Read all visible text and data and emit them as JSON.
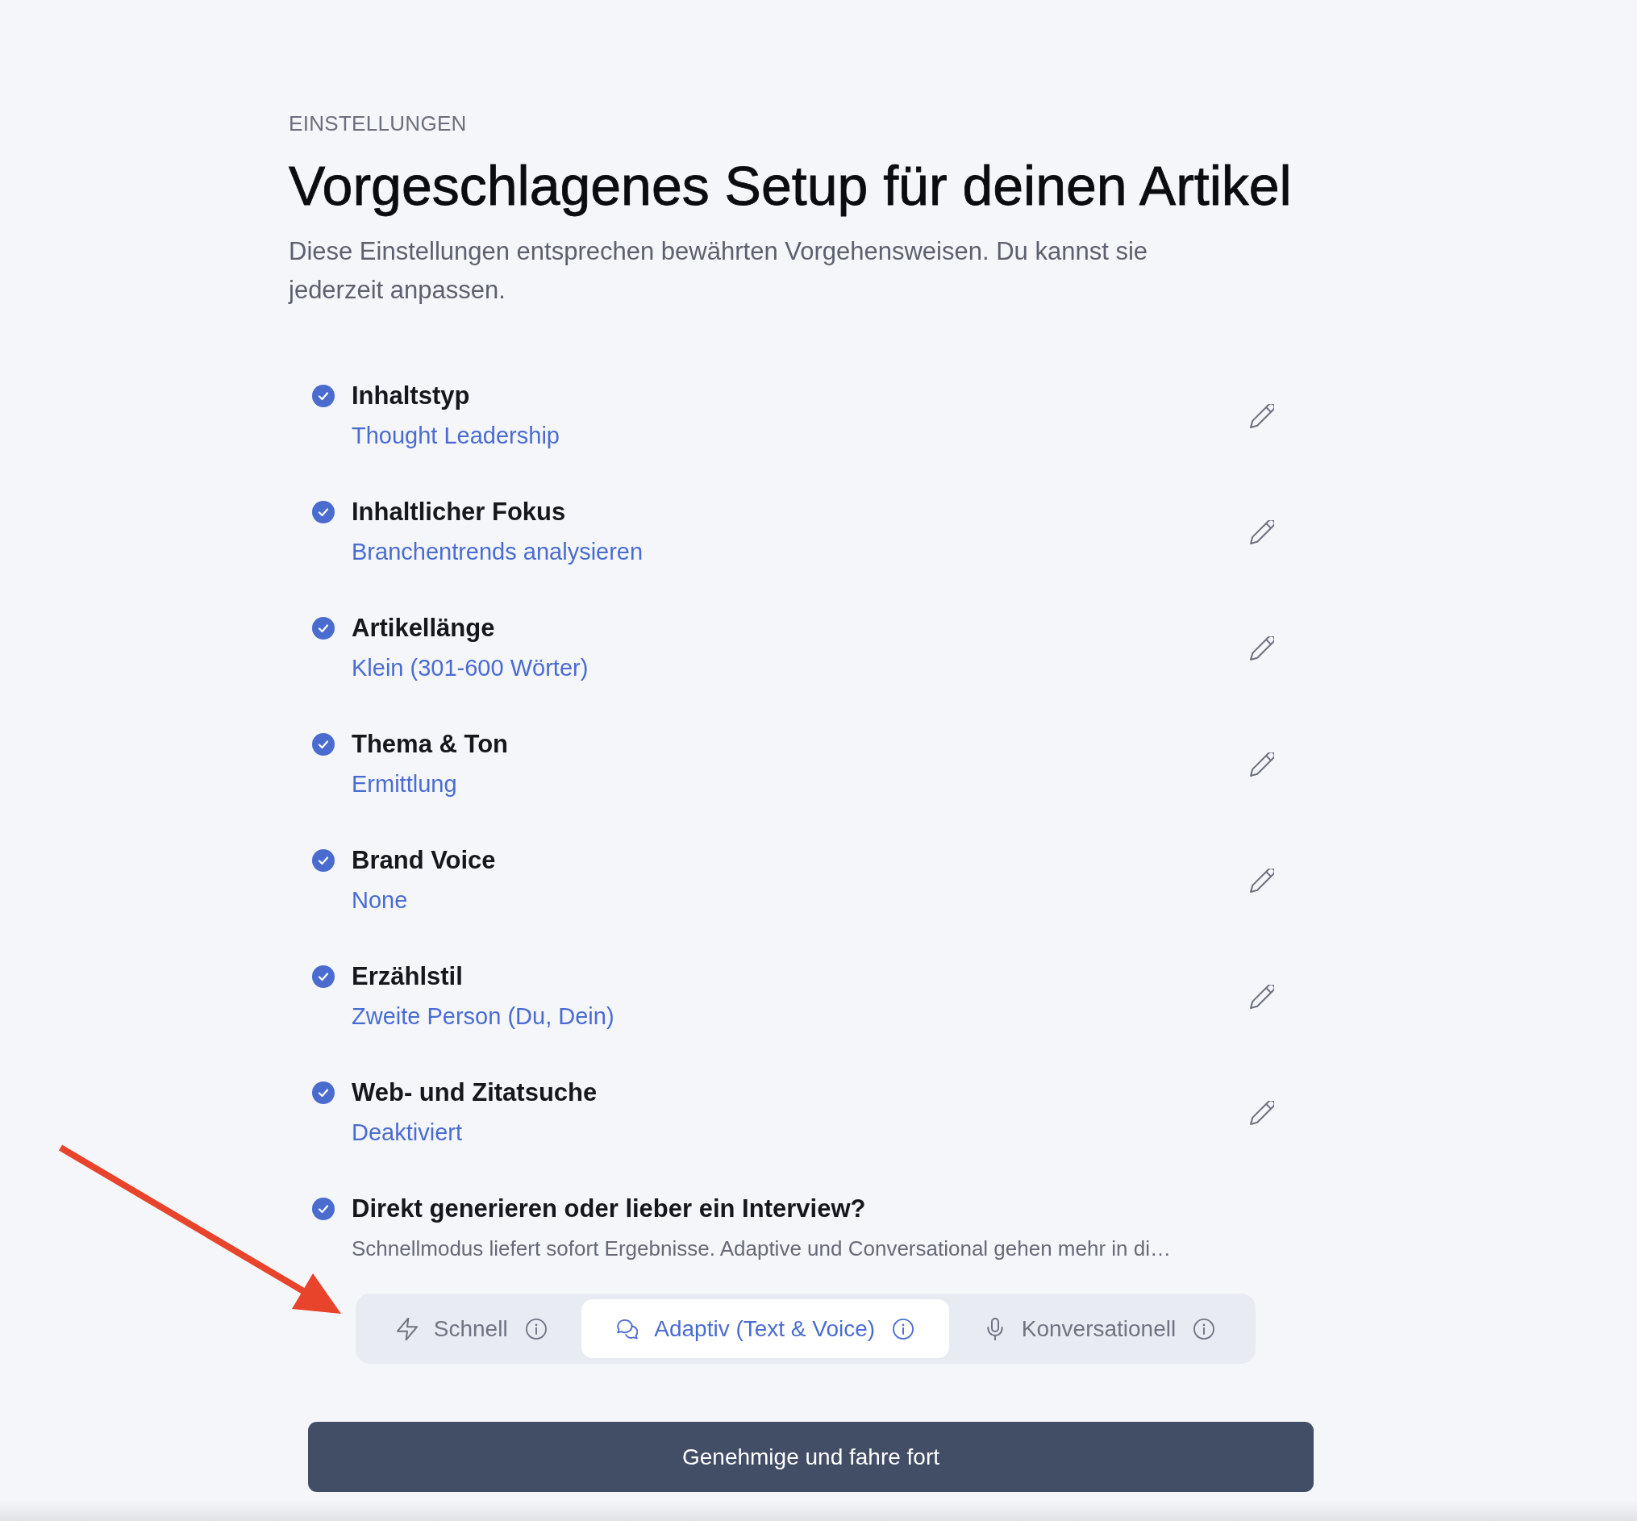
{
  "header": {
    "eyebrow": "EINSTELLUNGEN",
    "title": "Vorgeschlagenes Setup für deinen Artikel",
    "description": "Diese Einstellungen entsprechen bewährten Vorgehensweisen. Du kannst sie jederzeit anpassen."
  },
  "settings": [
    {
      "kind": "value",
      "checked": true,
      "label": "Inhaltstyp",
      "value": "Thought Leadership"
    },
    {
      "kind": "value",
      "checked": true,
      "label": "Inhaltlicher Fokus",
      "value": "Branchentrends analysieren"
    },
    {
      "kind": "value",
      "checked": true,
      "label": "Artikellänge",
      "value": "Klein (301-600 Wörter)"
    },
    {
      "kind": "value",
      "checked": true,
      "label": "Thema & Ton",
      "value": "Ermittlung"
    },
    {
      "kind": "value",
      "checked": true,
      "label": "Brand Voice",
      "value": "None"
    },
    {
      "kind": "value",
      "checked": true,
      "label": "Erzählstil",
      "value": "Zweite Person (Du, Dein)"
    },
    {
      "kind": "value",
      "checked": true,
      "label": "Web- und Zitatsuche",
      "value": "Deaktiviert"
    },
    {
      "kind": "choice",
      "checked": true,
      "label": "Direkt generieren oder lieber ein Interview?",
      "hint": "Schnellmodus liefert sofort Ergebnisse. Adaptive und Conversational gehen mehr in di…",
      "options": [
        {
          "label": "Schnell",
          "selected": false
        },
        {
          "label": "Adaptiv (Text & Voice)",
          "selected": true
        },
        {
          "label": "Konversationell",
          "selected": false
        }
      ]
    }
  ],
  "primary_button": {
    "label": "Genehmige und fahre fort"
  },
  "annotations": [
    {
      "kind": "arrow"
    }
  ]
}
